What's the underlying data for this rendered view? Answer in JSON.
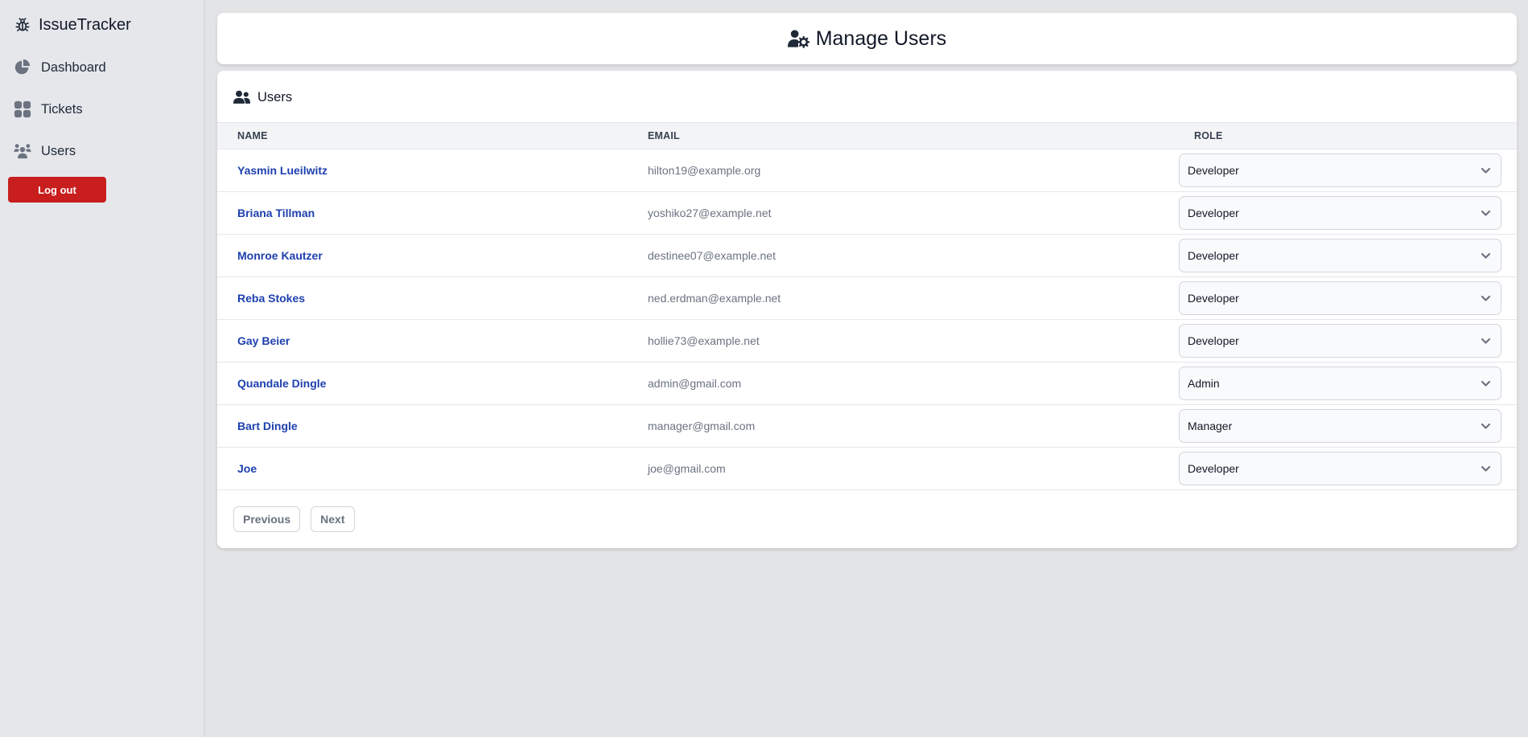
{
  "app": {
    "title": "IssueTracker"
  },
  "sidebar": {
    "items": [
      {
        "label": "Dashboard",
        "icon": "pie-chart-icon"
      },
      {
        "label": "Tickets",
        "icon": "grid-icon"
      },
      {
        "label": "Users",
        "icon": "users-icon"
      }
    ],
    "logout_label": "Log out"
  },
  "header": {
    "title": "Manage Users",
    "icon": "user-gear-icon"
  },
  "users_card": {
    "title": "Users",
    "columns": [
      "NAME",
      "EMAIL",
      "ROLE"
    ],
    "rows": [
      {
        "name": "Yasmin Lueilwitz",
        "email": "hilton19@example.org",
        "role": "Developer"
      },
      {
        "name": "Briana Tillman",
        "email": "yoshiko27@example.net",
        "role": "Developer"
      },
      {
        "name": "Monroe Kautzer",
        "email": "destinee07@example.net",
        "role": "Developer"
      },
      {
        "name": "Reba Stokes",
        "email": "ned.erdman@example.net",
        "role": "Developer"
      },
      {
        "name": "Gay Beier",
        "email": "hollie73@example.net",
        "role": "Developer"
      },
      {
        "name": "Quandale Dingle",
        "email": "admin@gmail.com",
        "role": "Admin"
      },
      {
        "name": "Bart Dingle",
        "email": "manager@gmail.com",
        "role": "Manager"
      },
      {
        "name": "Joe",
        "email": "joe@gmail.com",
        "role": "Developer"
      }
    ]
  },
  "pagination": {
    "previous_label": "Previous",
    "next_label": "Next"
  },
  "colors": {
    "link": "#1e40af",
    "danger": "#c81e1e",
    "sidebar_bg": "#e5e7eb",
    "icon_gray": "#6b7280"
  }
}
